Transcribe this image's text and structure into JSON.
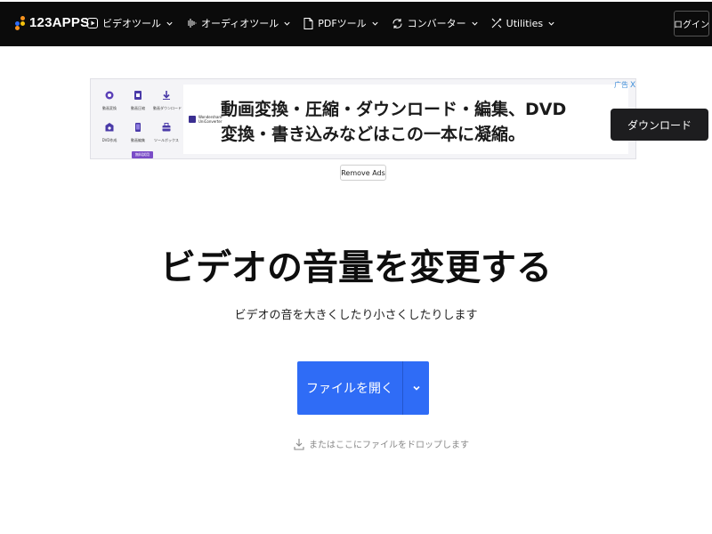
{
  "colors": {
    "nav_bg": "#0b0b0b",
    "primary": "#2f6cf6",
    "logo_dot_orange": "#f7931e",
    "logo_dot_blue": "#2f6cf6",
    "logo_dot_yellow": "#f4c20d",
    "ad_accent": "#7a4cc7"
  },
  "header": {
    "logo_text": "123APPS",
    "nav": [
      {
        "label": "ビデオツール",
        "icon": "play-square-icon"
      },
      {
        "label": "オーディオツール",
        "icon": "audio-wave-icon"
      },
      {
        "label": "PDFツール",
        "icon": "document-icon"
      },
      {
        "label": "コンバーター",
        "icon": "convert-icon"
      },
      {
        "label": "Utilities",
        "icon": "tools-icon"
      }
    ],
    "login_label": "ログイン"
  },
  "ad": {
    "adchoices_label": "广告",
    "close_label": "X",
    "headline_line1": "動画変換・圧縮・ダウンロード・編集、DVD",
    "headline_line2": "変換・書き込みなどはこの一本に凝縮。",
    "cta_label": "ダウンロード",
    "brand_line1": "Wondershare",
    "brand_line2": "UniConverter",
    "tools": [
      {
        "label": "動画変換",
        "icon": "video-convert-icon"
      },
      {
        "label": "動画圧縮",
        "icon": "compress-icon"
      },
      {
        "label": "動画ダウンロード",
        "icon": "download-icon"
      },
      {
        "label": "DVD作成",
        "icon": "dvd-icon"
      },
      {
        "label": "動画編集",
        "icon": "phone-icon"
      },
      {
        "label": "ツールボックス",
        "icon": "toolbox-icon"
      }
    ],
    "tools_button_label": "無料試用",
    "remove_ads_label": "Remove Ads"
  },
  "main": {
    "title": "ビデオの音量を変更する",
    "subtitle": "ビデオの音を大きくしたり小さくしたりします",
    "open_button_label": "ファイルを開く",
    "drop_hint": "またはここにファイルをドロップします"
  }
}
